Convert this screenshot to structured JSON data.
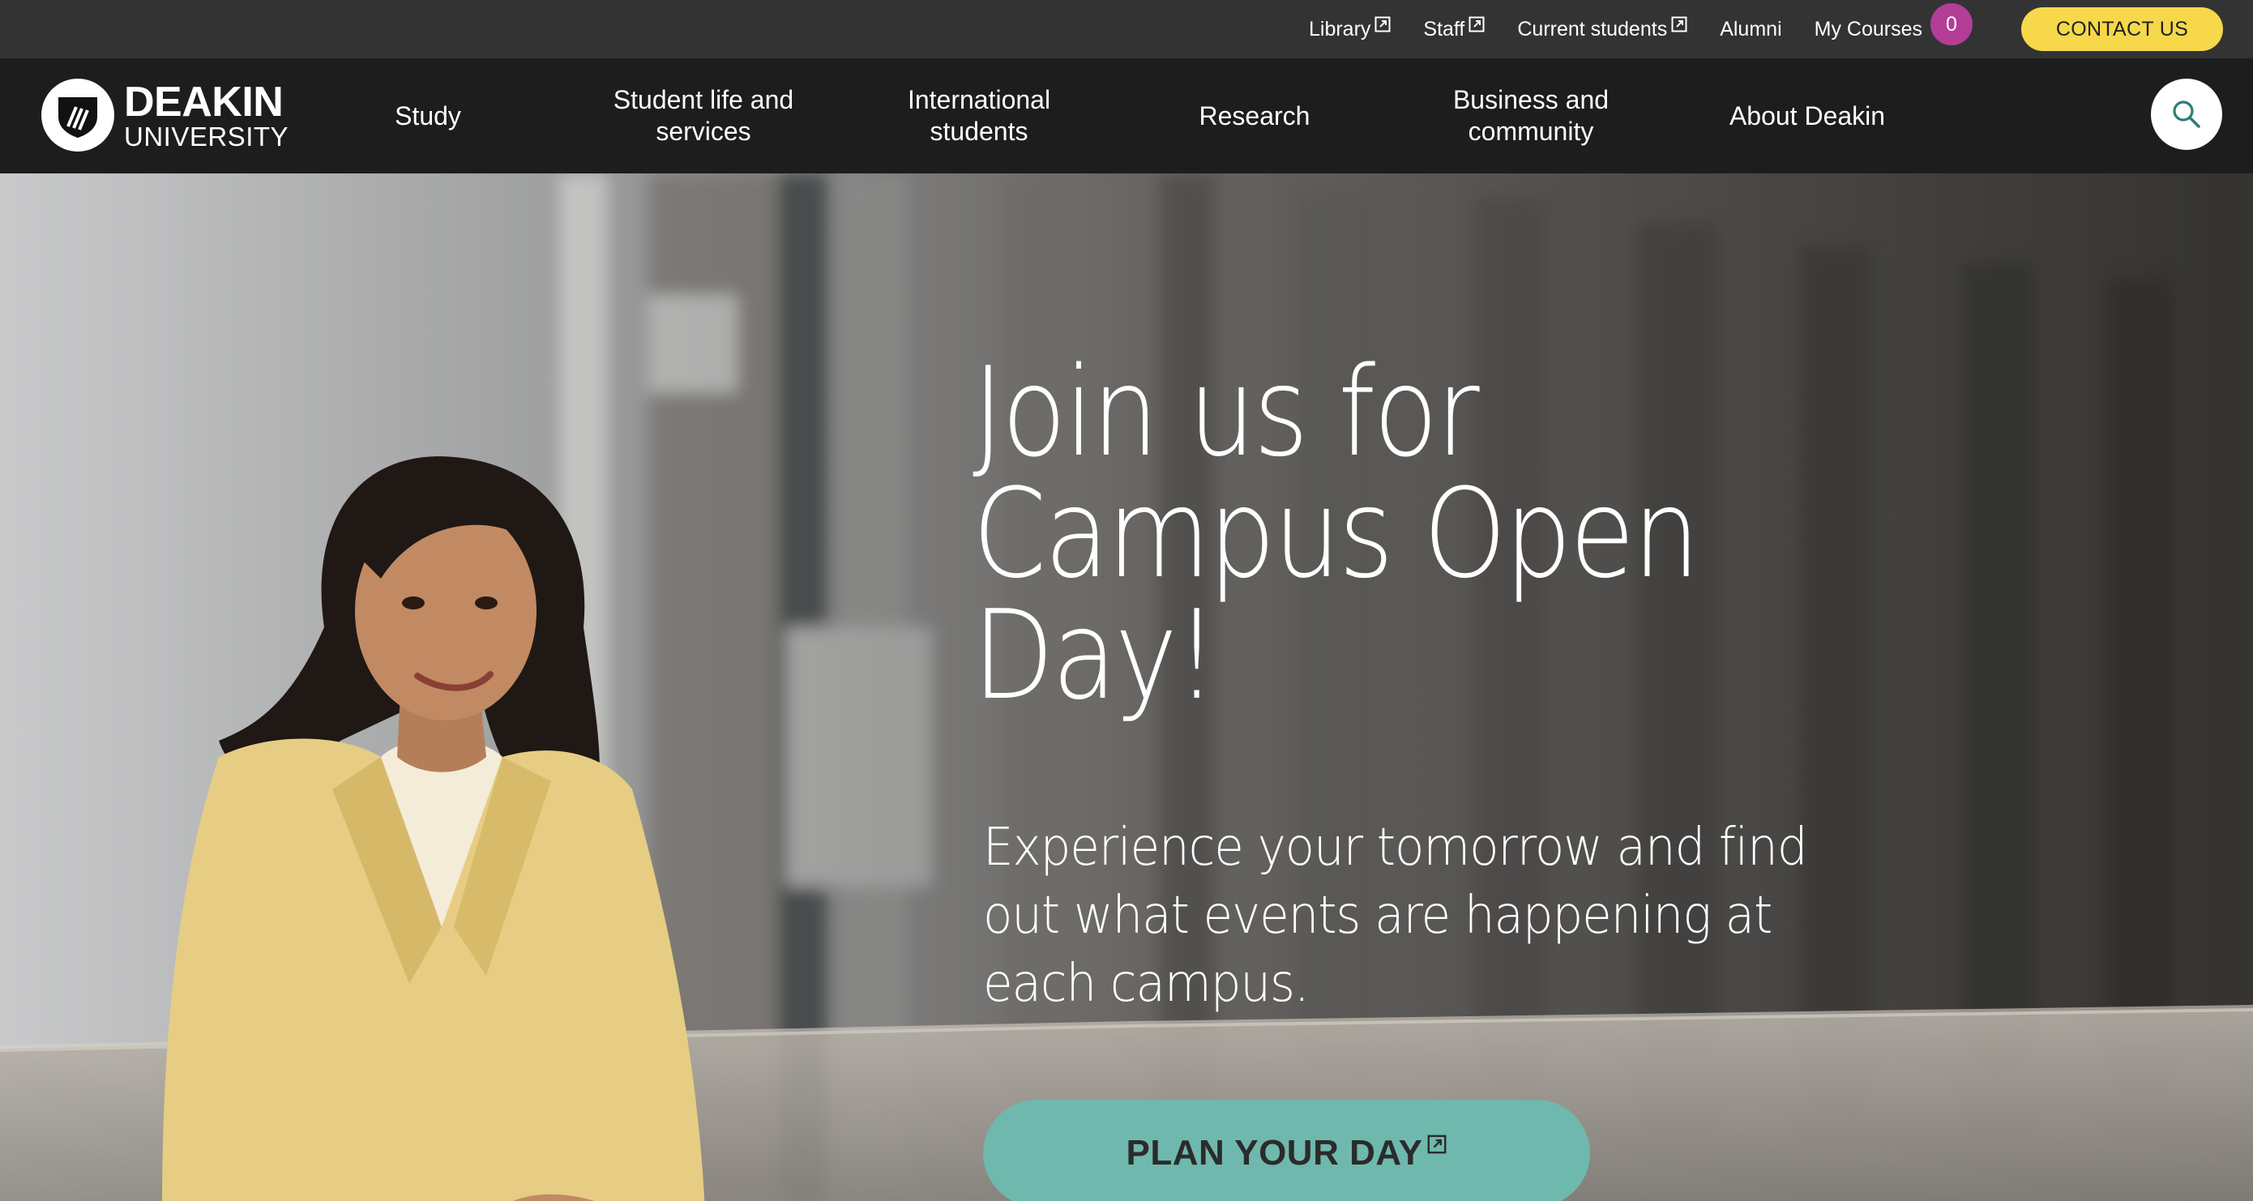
{
  "utility_nav": {
    "links": [
      {
        "label": "Library",
        "external": true
      },
      {
        "label": "Staff",
        "external": true
      },
      {
        "label": "Current students",
        "external": true
      },
      {
        "label": "Alumni",
        "external": false
      }
    ],
    "my_courses": {
      "label": "My Courses",
      "count": "0"
    },
    "contact_label": "CONTACT US"
  },
  "logo": {
    "name": "DEAKIN",
    "sub": "UNIVERSITY"
  },
  "main_nav": {
    "items": [
      "Study",
      "Student life and\nservices",
      "International\nstudents",
      "Research",
      "Business and\ncommunity",
      "About Deakin"
    ]
  },
  "hero": {
    "title": "Join us for Campus Open Day!",
    "subtitle": "Experience your tomorrow and find out what events are happening at each campus.",
    "cta_label": "PLAN YOUR DAY"
  },
  "colors": {
    "utility_bg": "#333334",
    "nav_bg": "#1d1d1d",
    "contact_yellow": "#f6d84a",
    "badge_magenta": "#b43d98",
    "cta_teal": "#6fb8ad",
    "search_teal": "#2a7f78"
  },
  "icons": {
    "external": "external-link-icon",
    "search": "search-icon",
    "logo": "deakin-shield-logo-icon"
  }
}
